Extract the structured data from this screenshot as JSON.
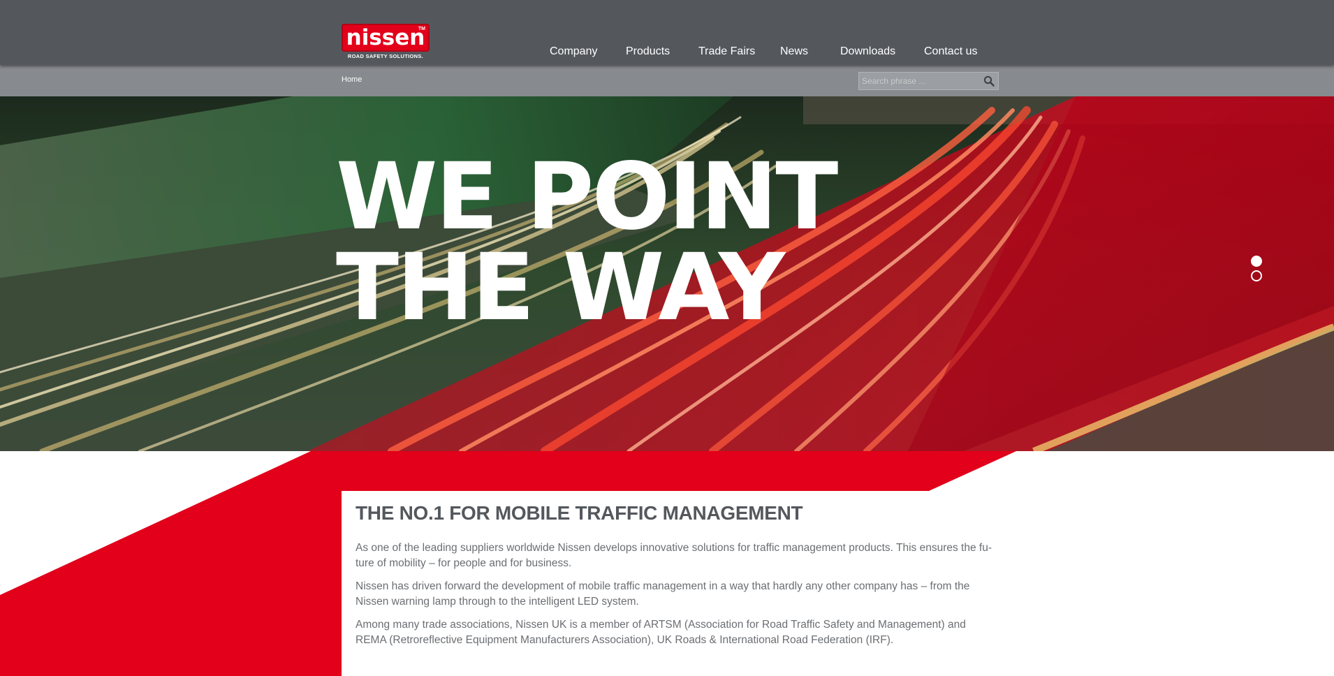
{
  "brand": {
    "name": "nissen",
    "trademark": "TM",
    "tagline": "ROAD SAFETY SOLUTIONS."
  },
  "nav": {
    "items": [
      "Company",
      "Products",
      "Trade Fairs",
      "News",
      "Downloads",
      "Contact us"
    ]
  },
  "breadcrumb": {
    "home": "Home"
  },
  "search": {
    "placeholder": "Search phrase ..."
  },
  "hero": {
    "line1": "WE POINT",
    "line2": "THE WAY",
    "slides": 2,
    "active_slide": 1
  },
  "main": {
    "title": "THE NO.1 FOR MOBILE TRAFFIC MANAGEMENT",
    "paragraphs": [
      "As one of the leading suppliers worldwide Nissen develops innovative solutions for traffic management products. This ensures the fu-ture of mobility – for people and for business.",
      "Nissen has driven forward the development of mobile traffic management in a way that hardly any other company has – from the Nissen warning lamp through to the intelligent LED system.",
      "Among many trade associations, Nissen UK is a member of ARTSM (Association for Road Traffic Safety and Management) and REMA (Retroreflective Equipment Manufacturers Association), UK Roads & International Road Federation (IRF)."
    ]
  },
  "colors": {
    "header": "#54585d",
    "subbar": "#878a8e",
    "brand_red": "#e2001a",
    "text": "#6b6e72"
  }
}
